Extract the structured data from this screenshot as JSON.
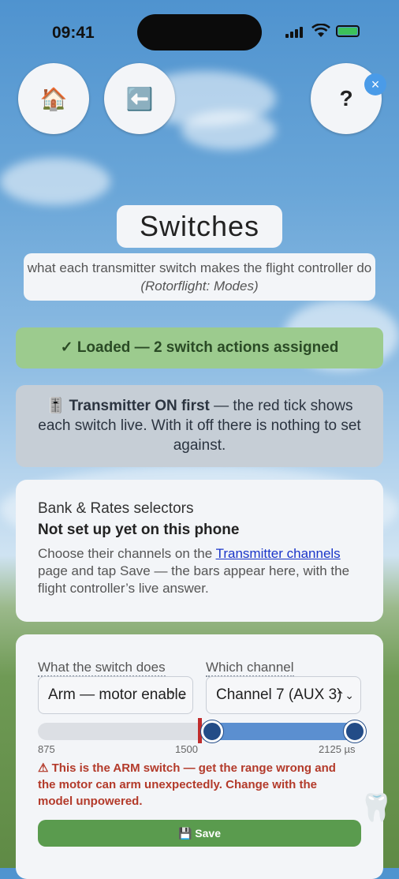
{
  "status_bar": {
    "time": "09:41"
  },
  "nav": {
    "home_icon": "🏠",
    "back_icon": "⬅️",
    "help_label": "?",
    "close_icon": "×"
  },
  "header": {
    "title": "Switches",
    "subtitle": "what each transmitter switch makes the flight controller do",
    "subtitle_note": "(Rotorflight: Modes)"
  },
  "loaded_banner": "✓ Loaded — 2 switch actions assigned",
  "tx_notice": {
    "icon": "🎚️",
    "bold": "Transmitter ON first",
    "text": " — the red tick shows each switch live. With it off there is nothing to set against."
  },
  "bank_card": {
    "heading": "Bank & Rates selectors",
    "status": "Not set up yet on this phone",
    "text_before": "Choose their channels on the ",
    "link": "Transmitter channels",
    "text_after": " page and tap Save — the bars appear here, with the flight controller’s live answer."
  },
  "switch_card": {
    "action_label": "What the switch does",
    "channel_label": "Which channel",
    "action_value": "Arm — motor enable",
    "channel_value": "Channel 7 (AUX 3)",
    "range": {
      "min": 875,
      "max": 2125,
      "live": 1500,
      "start": 1550,
      "end": 2100
    },
    "scale_min": "875",
    "scale_mid": "1500",
    "scale_max": "2125 µs",
    "warning": "⚠ This is the ARM switch — get the range wrong and the motor can arm unexpectedly. Change with the model unpowered.",
    "save_label": "💾 Save"
  },
  "floating_icon": "🦷",
  "colors": {
    "accent": "#5b8fd0",
    "tick": "#c02c2c",
    "save": "#5a9b4e",
    "warn": "#b33a2a"
  }
}
